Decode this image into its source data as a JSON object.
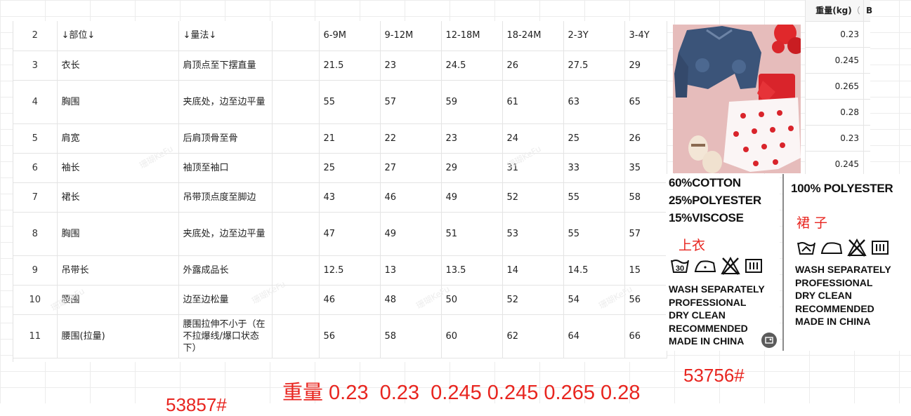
{
  "table": {
    "header": {
      "row": "2",
      "part": "↓部位↓",
      "method": "↓量法↓",
      "sizes": [
        "6-9M",
        "9-12M",
        "12-18M",
        "18-24M",
        "2-3Y",
        "3-4Y"
      ]
    },
    "rows": [
      {
        "row": "3",
        "part": "衣长",
        "method": "肩顶点至下摆直量",
        "values": [
          "21.5",
          "23",
          "24.5",
          "26",
          "27.5",
          "29"
        ]
      },
      {
        "row": "4",
        "part": "胸围",
        "method": "夹底处，边至边平量",
        "values": [
          "55",
          "57",
          "59",
          "61",
          "63",
          "65"
        ]
      },
      {
        "row": "5",
        "part": "肩宽",
        "method": "后肩顶骨至骨",
        "values": [
          "21",
          "22",
          "23",
          "24",
          "25",
          "26"
        ]
      },
      {
        "row": "6",
        "part": "袖长",
        "method": "袖顶至袖口",
        "values": [
          "25",
          "27",
          "29",
          "31",
          "33",
          "35"
        ]
      },
      {
        "row": "7",
        "part": "裙长",
        "method": "吊带顶点度至脚边",
        "values": [
          "43",
          "46",
          "49",
          "52",
          "55",
          "58"
        ]
      },
      {
        "row": "8",
        "part": "胸围",
        "method": "夹底处，边至边平量",
        "values": [
          "47",
          "49",
          "51",
          "53",
          "55",
          "57"
        ]
      },
      {
        "row": "9",
        "part": "吊带长",
        "method": "外露成品长",
        "values": [
          "12.5",
          "13",
          "13.5",
          "14",
          "14.5",
          "15"
        ]
      },
      {
        "row": "10",
        "part": "腰围",
        "method": "边至边松量",
        "values": [
          "46",
          "48",
          "50",
          "52",
          "54",
          "56"
        ]
      },
      {
        "row": "11",
        "part": "腰围(拉量)",
        "method": "腰围拉伸不小于（在不拉爆线/爆口状态下）",
        "values": [
          "56",
          "58",
          "60",
          "62",
          "64",
          "66"
        ]
      }
    ]
  },
  "watermark": "珊瑚KeFu",
  "weight_column": {
    "header": "重量(kg)",
    "header_extra": "（",
    "header_next": "B",
    "values": [
      "0.23",
      "0.245",
      "0.265",
      "0.28",
      "0.23",
      "0.245"
    ]
  },
  "labels": {
    "left": {
      "fabric": [
        "60%COTTON",
        "25%POLYESTER",
        "15%VISCOSE"
      ],
      "name": "上衣",
      "wash_temp": "30",
      "care": [
        "WASH SEPARATELY",
        "PROFESSIONAL",
        "DRY CLEAN",
        "RECOMMENDED",
        "MADE IN CHINA"
      ]
    },
    "right": {
      "fabric": [
        "100% POLYESTER"
      ],
      "name": "裙 子",
      "care": [
        "WASH SEPARATELY",
        "PROFESSIONAL",
        "DRY CLEAN",
        "RECOMMENDED",
        "MADE IN CHINA"
      ]
    }
  },
  "bottom": {
    "weight_line": "重量 0.23  0.23  0.245 0.245 0.265 0.28",
    "code_right": "53756#",
    "code_left_partial": "53857#"
  },
  "colors": {
    "accent_red": "#e8251f",
    "grid": "#e4e4e4"
  }
}
